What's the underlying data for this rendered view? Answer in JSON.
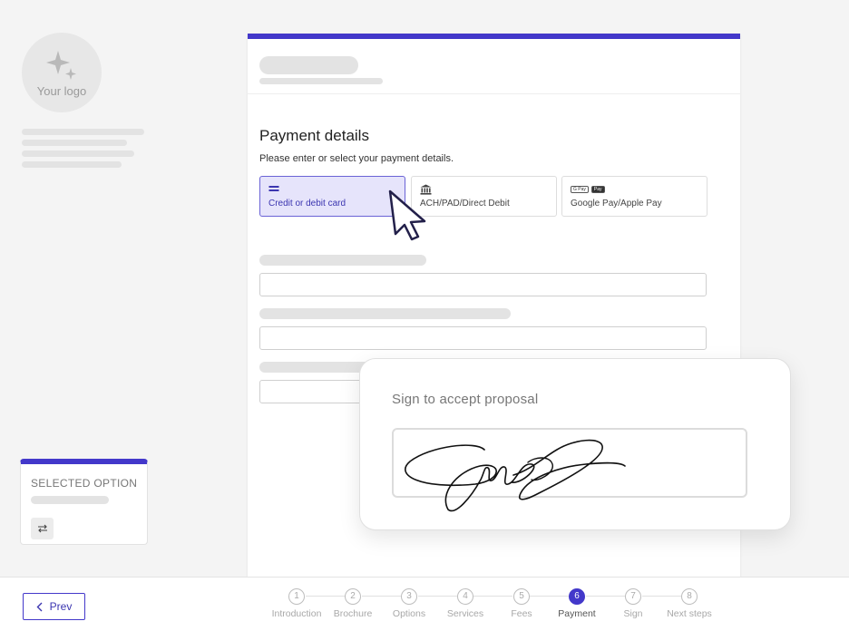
{
  "brand": {
    "logo_text": "Your logo"
  },
  "payment": {
    "title": "Payment details",
    "subtitle": "Please enter or select your payment details.",
    "options": [
      {
        "label": "Credit or debit card",
        "icon": "credit-card-icon",
        "selected": true
      },
      {
        "label": "ACH/PAD/Direct Debit",
        "icon": "bank-icon",
        "selected": false
      },
      {
        "label": "Google Pay/Apple Pay",
        "icon": "wallet-badges-icon",
        "selected": false,
        "badges": [
          "G Pay",
          "Pay"
        ]
      }
    ]
  },
  "selected_option": {
    "label": "SELECTED OPTION",
    "swap_icon": "swap-arrows-icon"
  },
  "sign": {
    "title": "Sign to accept proposal"
  },
  "nav": {
    "prev_label": "Prev",
    "steps": [
      {
        "num": "1",
        "label": "Introduction"
      },
      {
        "num": "2",
        "label": "Brochure"
      },
      {
        "num": "3",
        "label": "Options"
      },
      {
        "num": "4",
        "label": "Services"
      },
      {
        "num": "5",
        "label": "Fees"
      },
      {
        "num": "6",
        "label": "Payment",
        "active": true
      },
      {
        "num": "7",
        "label": "Sign"
      },
      {
        "num": "8",
        "label": "Next steps"
      }
    ]
  },
  "colors": {
    "accent": "#4338ca",
    "selected_bg": "#e6e4fb",
    "skeleton": "#e3e3e3"
  }
}
